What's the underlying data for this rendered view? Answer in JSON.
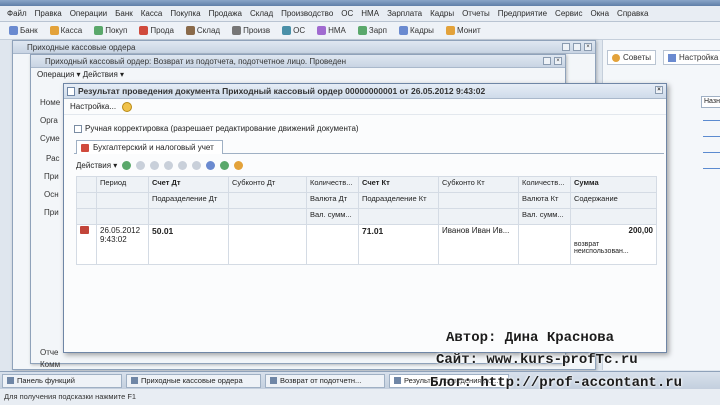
{
  "menu": [
    "Файл",
    "Правка",
    "Операции",
    "Банк",
    "Касса",
    "Покупка",
    "Продажа",
    "Склад",
    "Производство",
    "ОС",
    "НМА",
    "Зарплата",
    "Кадры",
    "Отчеты",
    "Предприятие",
    "Сервис",
    "Окна",
    "Справка"
  ],
  "toolbar": {
    "items": [
      "Банк",
      "Касса",
      "Покуп",
      "Прода",
      "Склад",
      "Произв",
      "ОС",
      "НМА",
      "Зарп",
      "Кадры",
      "Монит"
    ]
  },
  "right_panel": {
    "btn1": "Советы",
    "btn2": "Настройка",
    "field": "Назн"
  },
  "bg_windows": {
    "w1_title": "Приходные кассовые ордера",
    "w2_title": "Приходный кассовый ордер: Возврат из подотчета, подотчетное лицо. Проведен",
    "w2_toolbar": "Операция ▾   Действия ▾"
  },
  "side_labels": [
    "Номе",
    "Орга",
    "Суме",
    "Рас",
    "При",
    "Осн",
    "При",
    "Отче",
    "Комм"
  ],
  "main": {
    "title": "Результат проведения документа Приходный кассовый ордер 00000000001 от 26.05.2012 9:43:02",
    "settings": "Настройка...",
    "checkbox_label": "Ручная корректировка (разрешает редактирование движений документа)",
    "tab": "Бухгалтерский и налоговый учет",
    "actions": "Действия ▾",
    "headers_row1": [
      "",
      "Период",
      "Счет Дт",
      "Субконто Дт",
      "Количеств...",
      "Счет Кт",
      "Субконто Кт",
      "Количеств...",
      "Сумма"
    ],
    "headers_row2": [
      "",
      "",
      "Подразделение Дт",
      "",
      "Валюта Дт",
      "Подразделение Кт",
      "",
      "Валюта Кт",
      "Содержание"
    ],
    "headers_row3": [
      "",
      "",
      "",
      "",
      "Вал. сумм...",
      "",
      "",
      "Вал. сумм...",
      ""
    ],
    "row": {
      "period": "26.05.2012 9:43:02",
      "debit": "50.01",
      "credit": "71.01",
      "subkonto_kt": "Иванов Иван Ив...",
      "sum": "200,00",
      "content": "возврат неиспользован..."
    }
  },
  "taskbar": [
    "Панель функций",
    "Приходные кассовые ордера",
    "Возврат от подотчетн...",
    "Результат проведения до..."
  ],
  "status": "Для получения подсказки нажмите F1",
  "watermark": {
    "author": "Автор: Дина Краснова",
    "site": "Сайт: www.kurs-profTc.ru",
    "blog": "Блог: http://prof-accontant.ru"
  }
}
